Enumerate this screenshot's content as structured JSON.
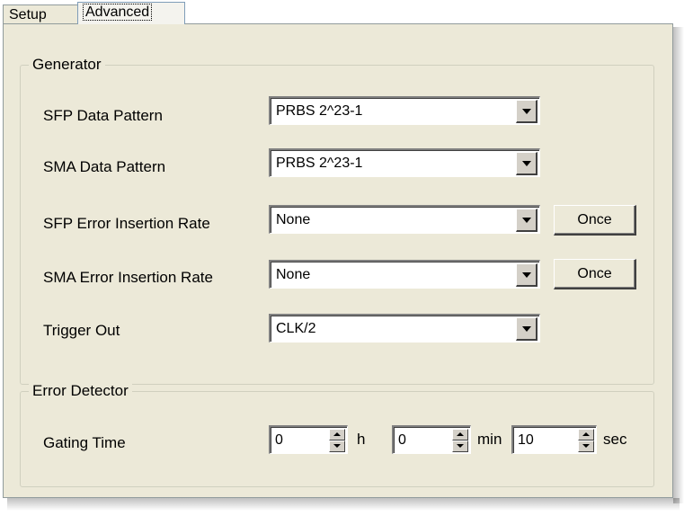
{
  "tabs": [
    {
      "label": "Setup"
    },
    {
      "label": "Advanced"
    }
  ],
  "generator": {
    "title": "Generator",
    "rows": [
      {
        "label": "SFP Data Pattern",
        "value": "PRBS 2^23-1"
      },
      {
        "label": "SMA Data Pattern",
        "value": "PRBS 2^23-1"
      },
      {
        "label": "SFP Error Insertion Rate",
        "value": "None",
        "button": "Once"
      },
      {
        "label": "SMA Error Insertion Rate",
        "value": "None",
        "button": "Once"
      },
      {
        "label": "Trigger Out",
        "value": "CLK/2"
      }
    ]
  },
  "error_detector": {
    "title": "Error Detector",
    "gating_label": "Gating Time",
    "hours": "0",
    "hours_unit": "h",
    "minutes": "0",
    "minutes_unit": "min",
    "seconds": "10",
    "seconds_unit": "sec"
  }
}
